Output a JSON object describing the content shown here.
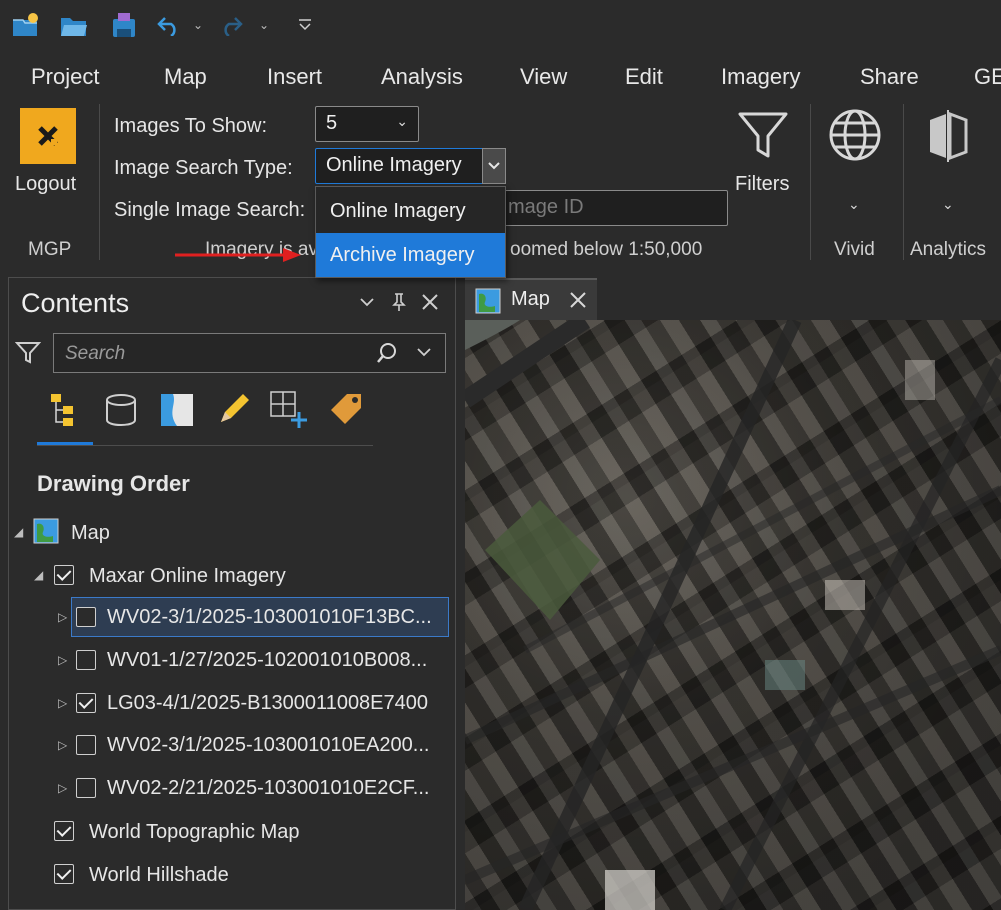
{
  "ribbon_tabs": [
    "Project",
    "Map",
    "Insert",
    "Analysis",
    "View",
    "Edit",
    "Imagery",
    "Share",
    "GE"
  ],
  "logout": {
    "label": "Logout",
    "group_label": "MGP"
  },
  "images_to_show": {
    "label": "Images To Show:",
    "value": "5"
  },
  "image_search_type": {
    "label": "Image Search Type:",
    "value": "Online Imagery",
    "options": [
      "Online Imagery",
      "Archive Imagery"
    ],
    "highlighted": "Archive Imagery"
  },
  "single_image_search": {
    "label": "Single Image Search:",
    "placeholder": "mage ID"
  },
  "status_text": {
    "left": "Imagery is av",
    "right": "oomed below 1:50,000"
  },
  "filters": {
    "label": "Filters"
  },
  "vivid": {
    "label": "Vivid"
  },
  "analytics": {
    "label": "Analytics"
  },
  "contents": {
    "title": "Contents",
    "search_placeholder": "Search",
    "section_title": "Drawing Order",
    "map_node": "Map",
    "layers": [
      {
        "name": "Maxar Online Imagery",
        "checked": true
      },
      {
        "name": "WV02-3/1/2025-103001010F13BC...",
        "checked": false,
        "selected": true
      },
      {
        "name": "WV01-1/27/2025-102001010B008...",
        "checked": false
      },
      {
        "name": "LG03-4/1/2025-B1300011008E7400",
        "checked": true
      },
      {
        "name": "WV02-3/1/2025-103001010EA200...",
        "checked": false
      },
      {
        "name": "WV02-2/21/2025-103001010E2CF...",
        "checked": false
      },
      {
        "name": "World Topographic Map",
        "checked": true
      },
      {
        "name": "World Hillshade",
        "checked": true
      }
    ]
  },
  "map_view": {
    "tab_label": "Map"
  },
  "colors": {
    "accent": "#1f7ad9",
    "logout_bg": "#f0a81e",
    "arrow": "#e02020"
  }
}
